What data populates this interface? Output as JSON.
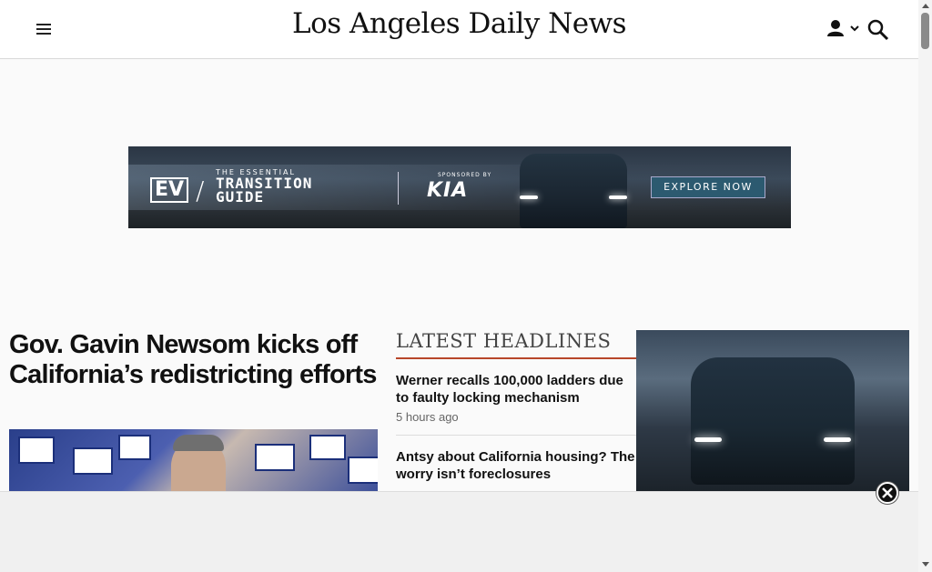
{
  "header": {
    "site_title": "Los Angeles Daily News",
    "menu_icon": "hamburger-menu-icon",
    "user_icon": "user-icon",
    "search_icon": "search-icon"
  },
  "top_ad": {
    "ev_badge": "EV",
    "kicker": "THE ESSENTIAL",
    "title_line1": "TRANSITION",
    "title_line2": "GUIDE",
    "sponsored_by": "SPONSORED BY",
    "brand": "KIA",
    "cta": "EXPLORE NOW"
  },
  "lead_story": {
    "headline": "Gov. Gavin Newsom kicks off California’s redistricting efforts"
  },
  "latest_headlines": {
    "title": "LATEST HEADLINES",
    "items": [
      {
        "headline": "Werner recalls 100,000 ladders due to faulty locking mechanism",
        "time": "5 hours ago"
      },
      {
        "headline": "Antsy about California housing? The worry isn’t foreclosures",
        "time": ""
      }
    ]
  },
  "colors": {
    "accent_rule": "#b8462a",
    "cta_bg": "#2c5a70"
  }
}
